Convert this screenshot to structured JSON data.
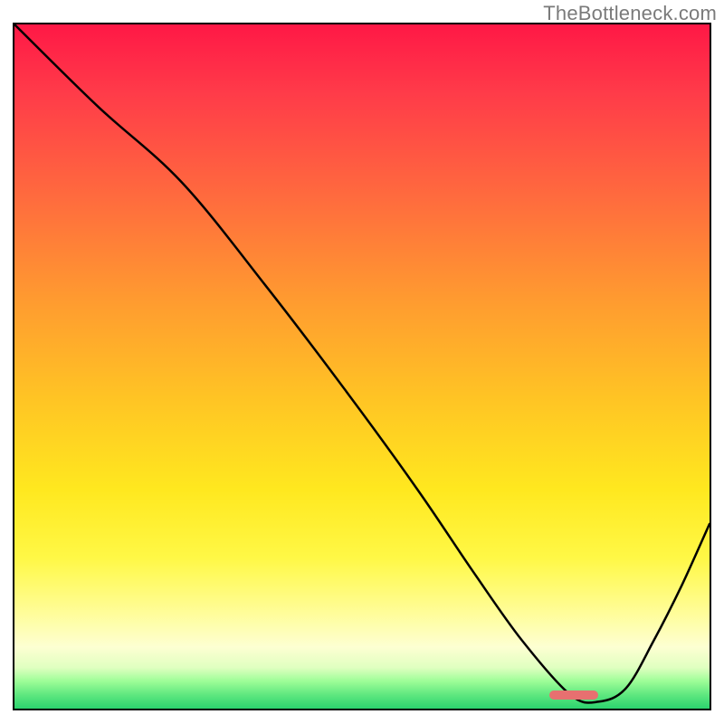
{
  "watermark": "TheBottleneck.com",
  "chart_data": {
    "type": "line",
    "title": "",
    "xlabel": "",
    "ylabel": "",
    "xlim": [
      0,
      100
    ],
    "ylim": [
      0,
      100
    ],
    "x": [
      0,
      12,
      24,
      36,
      48,
      58,
      66,
      73,
      80,
      84,
      88,
      92,
      96,
      100
    ],
    "values": [
      100,
      88,
      77,
      62,
      46,
      32,
      20,
      10,
      2,
      1,
      3,
      10,
      18,
      27
    ],
    "grid": false,
    "legend": null,
    "annotations": {
      "marker": {
        "x_start": 77,
        "x_end": 84,
        "y": 2,
        "color": "#e77070"
      }
    },
    "background_gradient": {
      "direction": "vertical",
      "stops": [
        {
          "at": 0.0,
          "color": "#ff1846"
        },
        {
          "at": 0.1,
          "color": "#ff3b49"
        },
        {
          "at": 0.25,
          "color": "#ff6a3e"
        },
        {
          "at": 0.4,
          "color": "#ff9a30"
        },
        {
          "at": 0.55,
          "color": "#ffc524"
        },
        {
          "at": 0.68,
          "color": "#ffe81f"
        },
        {
          "at": 0.78,
          "color": "#fff846"
        },
        {
          "at": 0.86,
          "color": "#fffd99"
        },
        {
          "at": 0.91,
          "color": "#fdffd2"
        },
        {
          "at": 0.94,
          "color": "#e0ffc0"
        },
        {
          "at": 0.96,
          "color": "#9dfd97"
        },
        {
          "at": 0.98,
          "color": "#5ee77f"
        },
        {
          "at": 1.0,
          "color": "#2bd36e"
        }
      ]
    }
  }
}
